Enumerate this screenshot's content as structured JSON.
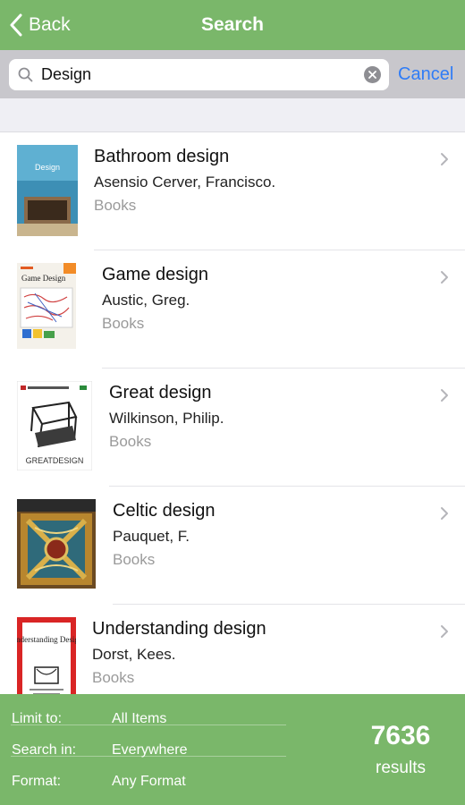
{
  "navbar": {
    "back_label": "Back",
    "title": "Search"
  },
  "search": {
    "query": "Design",
    "cancel_label": "Cancel"
  },
  "results": [
    {
      "title": "Bathroom design",
      "author": "Asensio Cerver, Francisco.",
      "format": "Books",
      "cover_text": "Design"
    },
    {
      "title": "Game design",
      "author": "Austic, Greg.",
      "format": "Books",
      "cover_text": "Game Design"
    },
    {
      "title": "Great design",
      "author": "Wilkinson, Philip.",
      "format": "Books",
      "cover_text": "GREATDESIGN"
    },
    {
      "title": "Celtic design",
      "author": "Pauquet, F.",
      "format": "Books",
      "cover_text": ""
    },
    {
      "title": "Understanding design",
      "author": "Dorst, Kees.",
      "format": "Books",
      "cover_text": "Understanding Design"
    }
  ],
  "footer": {
    "filters": [
      {
        "label": "Limit to:",
        "value": "All Items"
      },
      {
        "label": "Search in:",
        "value": "Everywhere"
      },
      {
        "label": "Format:",
        "value": "Any Format"
      }
    ],
    "result_count": "7636",
    "result_label": "results"
  },
  "colors": {
    "brand_green": "#7ab76a",
    "link_blue": "#2f7cf6",
    "secondary_gray": "#9a9a9a"
  }
}
